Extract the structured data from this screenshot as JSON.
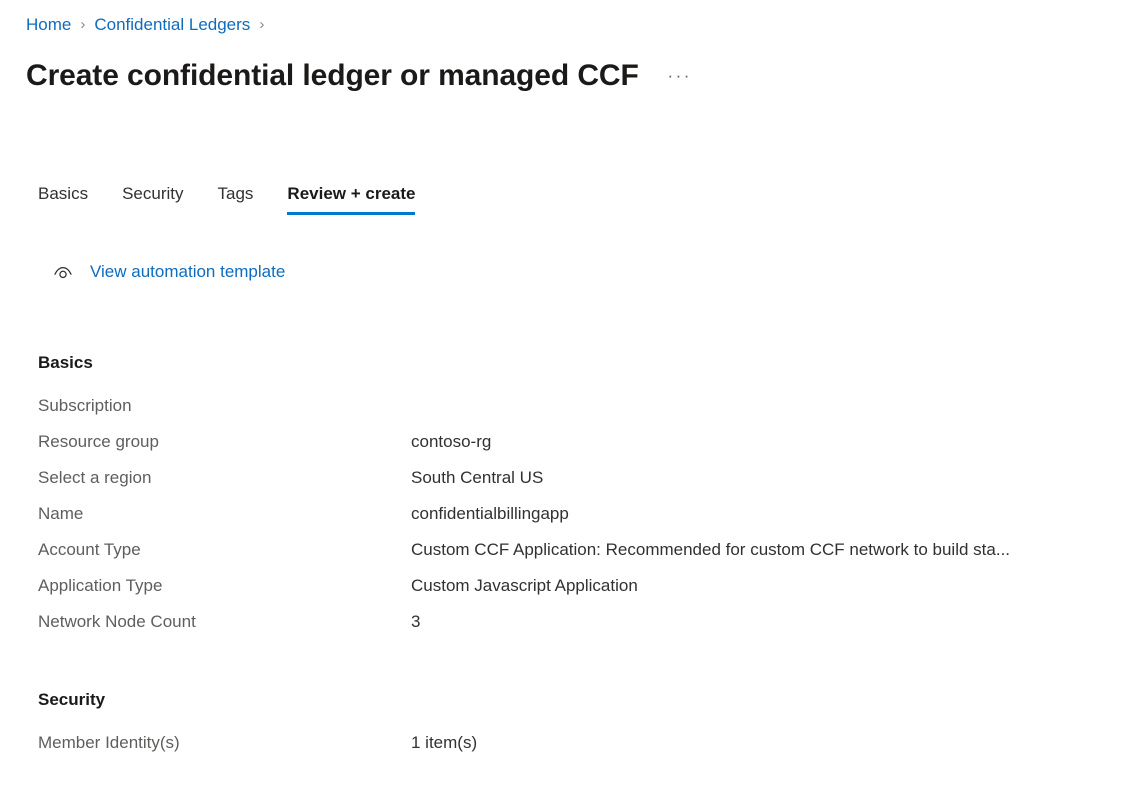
{
  "breadcrumb": {
    "items": [
      {
        "label": "Home"
      },
      {
        "label": "Confidential Ledgers"
      }
    ],
    "separator": "›"
  },
  "header": {
    "title": "Create confidential ledger or managed CCF",
    "more_menu_label": "···"
  },
  "tabs": [
    {
      "label": "Basics",
      "active": false
    },
    {
      "label": "Security",
      "active": false
    },
    {
      "label": "Tags",
      "active": false
    },
    {
      "label": "Review + create",
      "active": true
    }
  ],
  "commands": {
    "view_template": {
      "label": "View automation template",
      "icon": "eye-icon"
    }
  },
  "sections": [
    {
      "heading": "Basics",
      "rows": [
        {
          "key": "Subscription",
          "value": ""
        },
        {
          "key": "Resource group",
          "value": "contoso-rg"
        },
        {
          "key": "Select a region",
          "value": "South Central US"
        },
        {
          "key": "Name",
          "value": "confidentialbillingapp"
        },
        {
          "key": "Account Type",
          "value": "Custom CCF Application: Recommended for custom CCF network to build sta..."
        },
        {
          "key": "Application Type",
          "value": "Custom Javascript Application"
        },
        {
          "key": "Network Node Count",
          "value": "3"
        }
      ]
    },
    {
      "heading": "Security",
      "rows": [
        {
          "key": "Member Identity(s)",
          "value": "1 item(s)"
        }
      ]
    }
  ],
  "colors": {
    "link": "#0f6cbd",
    "accent": "#0078d4",
    "label": "#605e5c",
    "value": "#323130",
    "title": "#1b1a19",
    "background": "#ffffff"
  }
}
